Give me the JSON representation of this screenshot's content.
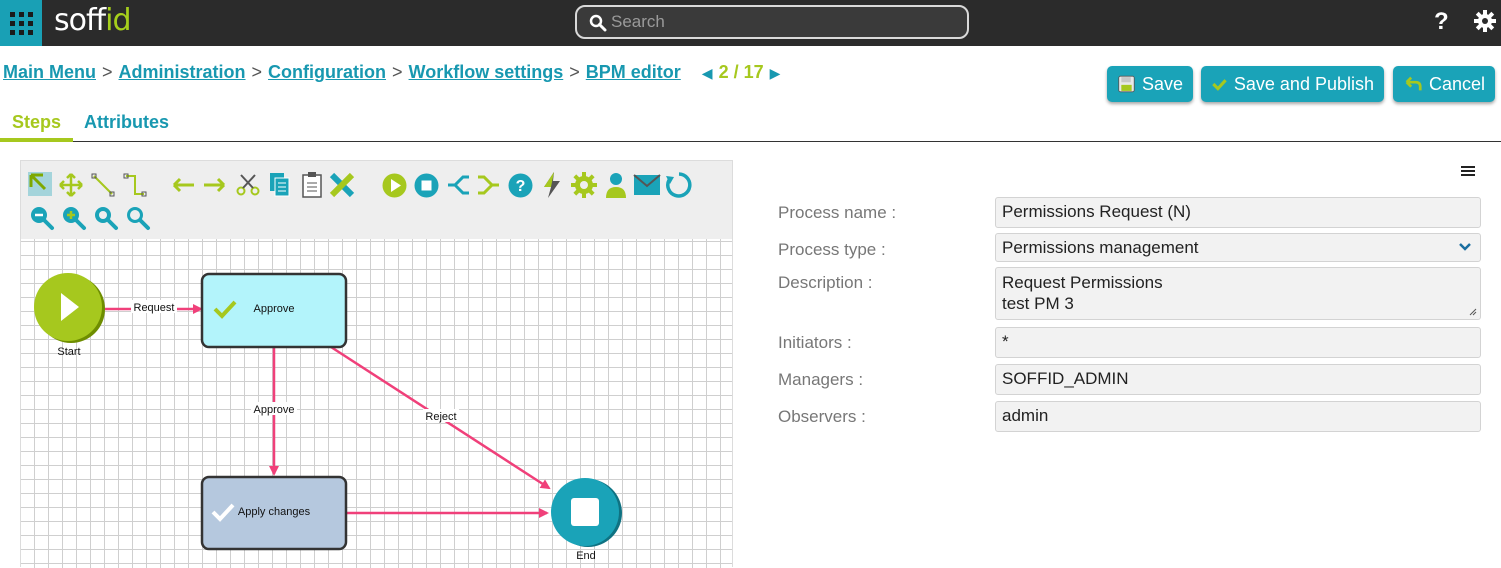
{
  "app": {
    "logo_text_a": "so",
    "logo_text_b": "ff",
    "logo_text_c": "id",
    "search_placeholder": "Search",
    "help_label": "?"
  },
  "breadcrumb": {
    "items": [
      "Main Menu",
      "Administration",
      "Configuration",
      "Workflow settings",
      "BPM editor"
    ],
    "separator": ">",
    "pager": "2 / 17"
  },
  "actions": {
    "save": "Save",
    "save_publish": "Save and Publish",
    "cancel": "Cancel"
  },
  "tabs": {
    "steps": "Steps",
    "attributes": "Attributes"
  },
  "diagram": {
    "nodes": {
      "start": "Start",
      "approve": "Approve",
      "apply": "Apply changes",
      "end": "End"
    },
    "edges": {
      "request": "Request",
      "approve": "Approve",
      "reject": "Reject"
    }
  },
  "form": {
    "process_name": {
      "label": "Process name :",
      "value": "Permissions Request (N)"
    },
    "process_type": {
      "label": "Process type :",
      "value": "Permissions management"
    },
    "description": {
      "label": "Description :",
      "line1": "Request Permissions",
      "line2": "test PM 3"
    },
    "initiators": {
      "label": "Initiators :",
      "value": "*"
    },
    "managers": {
      "label": "Managers :",
      "value": "SOFFID_ADMIN"
    },
    "observers": {
      "label": "Observers :",
      "value": "admin"
    }
  },
  "colors": {
    "topbar": "#2b2b2b",
    "accent_teal": "#1aa3b8",
    "accent_green": "#a6c81e",
    "edge_pink": "#f0407a",
    "task_approve": "#b3f4fb",
    "task_apply": "#b5c8de"
  }
}
